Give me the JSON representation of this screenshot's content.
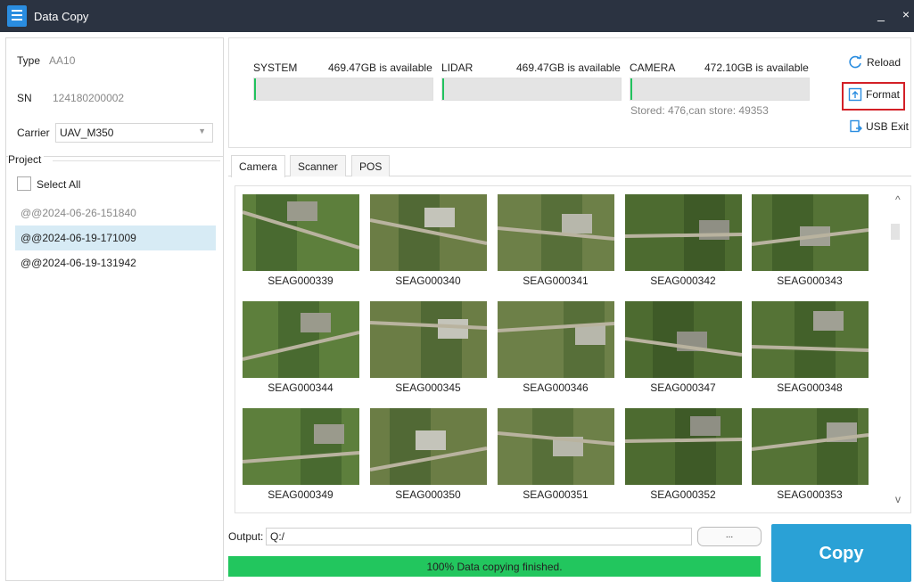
{
  "window": {
    "title": "Data Copy",
    "minimize": "_",
    "close": "×"
  },
  "device": {
    "type_label": "Type",
    "type_value": "AA10",
    "sn_label": "SN",
    "sn_value": "124180200002",
    "carrier_label": "Carrier",
    "carrier_value": "UAV_M350"
  },
  "project": {
    "title": "Project",
    "select_all": "Select All",
    "items": [
      "@@2024-06-26-151840",
      "@@2024-06-19-171009",
      "@@2024-06-19-131942"
    ],
    "selected_index": 1
  },
  "storage": [
    {
      "name": "SYSTEM",
      "available": "469.47GB is available",
      "fill_fraction": 0.01
    },
    {
      "name": "LIDAR",
      "available": "469.47GB is available",
      "fill_fraction": 0.01
    },
    {
      "name": "CAMERA",
      "available": "472.10GB is available",
      "fill_fraction": 0.01
    }
  ],
  "stored_text": "Stored: 476,can store: 49353",
  "actions": {
    "reload": "Reload",
    "format": "Format",
    "usb_exit": "USB Exit"
  },
  "tabs": [
    "Camera",
    "Scanner",
    "POS"
  ],
  "active_tab": "Camera",
  "images": [
    "SEAG000339",
    "SEAG000340",
    "SEAG000341",
    "SEAG000342",
    "SEAG000343",
    "SEAG000344",
    "SEAG000345",
    "SEAG000346",
    "SEAG000347",
    "SEAG000348",
    "SEAG000349",
    "SEAG000350",
    "SEAG000351",
    "SEAG000352",
    "SEAG000353"
  ],
  "scroll": {
    "up": "^",
    "down": "v"
  },
  "output": {
    "label": "Output:",
    "value": "Q:/",
    "browse": "..."
  },
  "progress": {
    "text": "100% Data copying finished.",
    "percent": 100
  },
  "copy_label": "Copy",
  "colors": {
    "titlebar": "#2b3341",
    "accent": "#2aa1d6",
    "progress": "#22c65e",
    "highlight": "#d32027"
  }
}
